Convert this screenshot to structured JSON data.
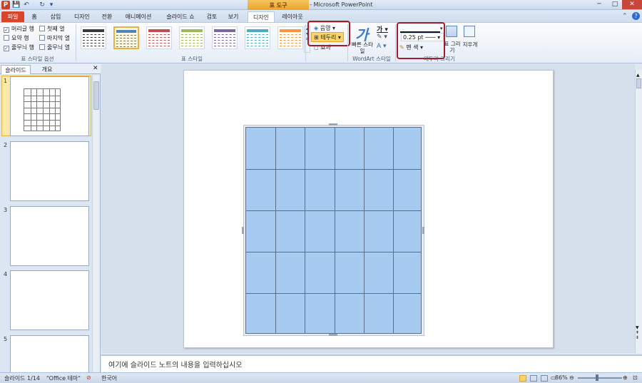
{
  "titlebar": {
    "title": "새 프레젠테이션 - Microsoft PowerPoint",
    "app_icon": "P",
    "context_tab": "표 도구"
  },
  "qat": {
    "save": "💾",
    "undo": "↶",
    "redo": "↻",
    "customize": "▾"
  },
  "window": {
    "minimize": "─",
    "maximize": "□",
    "close": "✕"
  },
  "tabs": [
    "파일",
    "홈",
    "삽입",
    "디자인",
    "전환",
    "애니메이션",
    "슬라이드 쇼",
    "검토",
    "보기",
    "디자인",
    "레이아웃"
  ],
  "ribbon": {
    "style_options": {
      "label": "표 스타일 옵션",
      "items": [
        {
          "label": "머리글 행",
          "checked": true
        },
        {
          "label": "첫째 열",
          "checked": false
        },
        {
          "label": "요약 행",
          "checked": false
        },
        {
          "label": "마지막 열",
          "checked": false
        },
        {
          "label": "줄무늬 행",
          "checked": true
        },
        {
          "label": "줄무늬 열",
          "checked": false
        }
      ]
    },
    "table_styles": {
      "label": "표 스타일",
      "colors": [
        "#3a3a3a",
        "#4f81bd",
        "#c0504d",
        "#9bbb59",
        "#8064a2",
        "#4bacc6",
        "#f79646"
      ]
    },
    "shading": "음영",
    "borders": "테두리",
    "effects": "효과",
    "wordart": {
      "label": "WordArt 스타일",
      "quick_styles": "빠른 스타일"
    },
    "draw_borders": {
      "label": "테두리 그리기",
      "pen_weight": "0.25 pt",
      "pen_color": "펜 색",
      "draw_table": "표 그리기",
      "eraser": "지우개"
    }
  },
  "left_pane": {
    "tab_slides": "슬라이드",
    "tab_outline": "개요",
    "slide_numbers": [
      "1",
      "2",
      "3",
      "4",
      "5"
    ]
  },
  "notes": {
    "placeholder": "여기에 슬라이드 노트의 내용을 입력하십시오"
  },
  "status": {
    "slide": "슬라이드 1/14",
    "theme": "\"Office 테마\"",
    "language": "한국어",
    "zoom": "86%"
  }
}
